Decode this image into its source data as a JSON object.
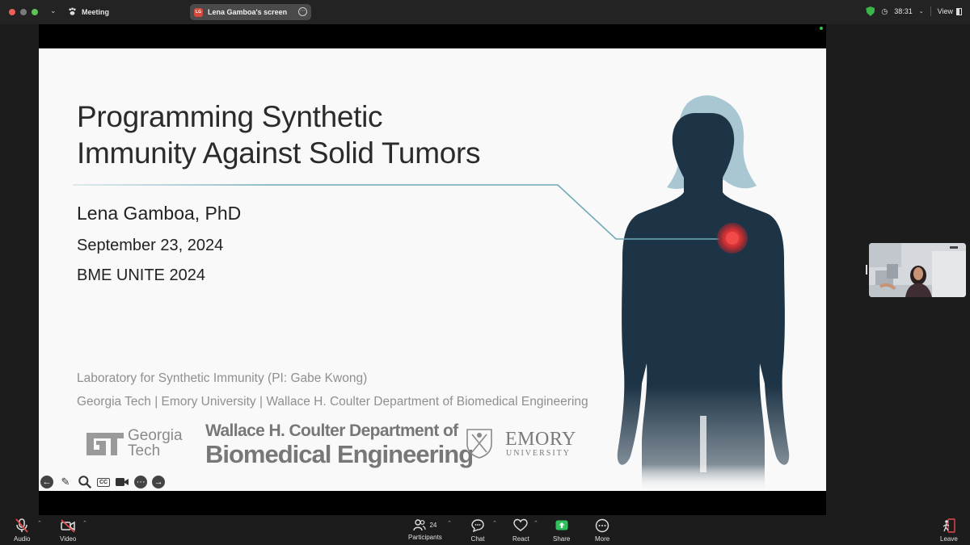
{
  "titlebar": {
    "meeting_label": "Meeting",
    "share_badge": "LG",
    "share_label": "Lena Gamboa's screen",
    "timer": "38:31",
    "view_label": "View"
  },
  "slide": {
    "title_line1": "Programming Synthetic",
    "title_line2": "Immunity Against Solid Tumors",
    "presenter": "Lena Gamboa, PhD",
    "date": "September 23, 2024",
    "conference": "BME UNITE 2024",
    "lab": "Laboratory for Synthetic Immunity (PI: Gabe Kwong)",
    "affiliations": "Georgia Tech | Emory University | Wallace H. Coulter Department of Biomedical Engineering",
    "logo_gt_line1": "Georgia",
    "logo_gt_line2": "Tech",
    "logo_coulter_line1": "Wallace H. Coulter Department of",
    "logo_coulter_line2": "Biomedical Engineering",
    "logo_emory_line1": "EMORY",
    "logo_emory_line2": "UNIVERSITY",
    "cc_label": "CC"
  },
  "toolbar": {
    "audio": "Audio",
    "video": "Video",
    "participants": "Participants",
    "participants_count": "24",
    "chat": "Chat",
    "react": "React",
    "share": "Share",
    "more": "More",
    "leave": "Leave"
  },
  "colors": {
    "figure": "#1d3446",
    "hair": "#a9c7d3",
    "tumor": "#d9393b",
    "accent_line": "#7fb3c0",
    "share_green": "#2fbf5c"
  }
}
